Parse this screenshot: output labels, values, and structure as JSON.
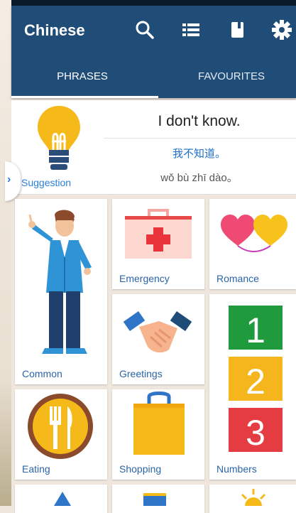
{
  "app": {
    "title": "Chinese"
  },
  "tabs": [
    {
      "label": "PHRASES"
    },
    {
      "label": "FAVOURITES"
    }
  ],
  "icons": {
    "search": "search-icon",
    "list": "list-icon",
    "book": "book-icon",
    "settings": "gear-icon"
  },
  "suggestion": {
    "label": "Suggestion",
    "english": "I don't know.",
    "chinese": "我不知道。",
    "pinyin": "wǒ bù zhī dào。"
  },
  "categories": [
    {
      "label": "Common"
    },
    {
      "label": "Emergency"
    },
    {
      "label": "Romance"
    },
    {
      "label": "Greetings"
    },
    {
      "label": "Numbers"
    },
    {
      "label": "Eating"
    },
    {
      "label": "Shopping"
    }
  ],
  "colors": {
    "appbar": "#1f4d78",
    "accent_text": "#2a64a8",
    "chinese_text": "#1e6fc8"
  }
}
